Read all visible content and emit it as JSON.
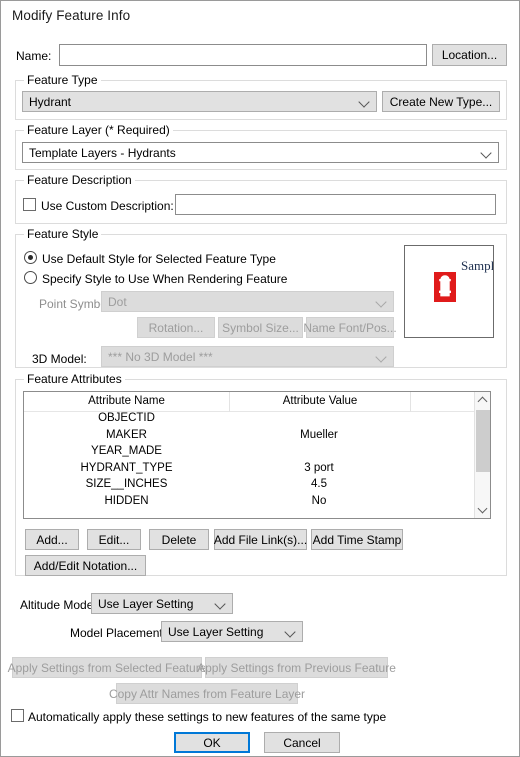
{
  "window": {
    "title": "Modify Feature Info"
  },
  "name_row": {
    "label": "Name:",
    "value": "",
    "placeholder": "",
    "location_button": "Location..."
  },
  "feature_type": {
    "group_title": "Feature Type",
    "selected": "Hydrant",
    "create_button": "Create New Type..."
  },
  "feature_layer": {
    "group_title": "Feature Layer (* Required)",
    "selected": "Template Layers - Hydrants"
  },
  "feature_description": {
    "group_title": "Feature Description",
    "checkbox_label": "Use Custom Description:",
    "checked": false,
    "value": ""
  },
  "feature_style": {
    "group_title": "Feature Style",
    "radio_default": "Use Default Style for Selected Feature Type",
    "radio_specify": "Specify Style to Use When Rendering Feature",
    "selected_radio": "default",
    "point_symbol_label": "Point Symbol",
    "point_symbol_value": "Dot",
    "rotation_button": "Rotation...",
    "symbol_size_button": "Symbol Size...",
    "name_font_button": "Name Font/Pos...",
    "model_3d_label": "3D Model:",
    "model_3d_value": "*** No 3D Model ***",
    "sample_text": "Sample",
    "sample_swatch_color": "#e01b1b"
  },
  "feature_attributes": {
    "group_title": "Feature Attributes",
    "columns": [
      "Attribute Name",
      "Attribute Value"
    ],
    "rows": [
      {
        "name": "OBJECTID",
        "value": ""
      },
      {
        "name": "MAKER",
        "value": "Mueller"
      },
      {
        "name": "YEAR_MADE",
        "value": ""
      },
      {
        "name": "HYDRANT_TYPE",
        "value": "3 port"
      },
      {
        "name": "SIZE__INCHES",
        "value": "4.5"
      },
      {
        "name": "HIDDEN",
        "value": "No"
      }
    ],
    "buttons": {
      "add": "Add...",
      "edit": "Edit...",
      "delete": "Delete",
      "add_file_links": "Add File Link(s)...",
      "add_time_stamp": "Add Time Stamp",
      "add_edit_notation": "Add/Edit Notation..."
    }
  },
  "altitude": {
    "label": "Altitude Mode:",
    "value": "Use Layer Setting"
  },
  "model_placement": {
    "label": "Model Placement:",
    "value": "Use Layer Setting"
  },
  "apply_buttons": {
    "from_selected": "Apply Settings from Selected Feature",
    "from_previous": "Apply Settings from Previous Feature",
    "copy_attr_names": "Copy Attr Names from Feature Layer"
  },
  "auto_apply": {
    "label": "Automatically apply these settings to new features of the same type",
    "checked": false
  },
  "footer": {
    "ok": "OK",
    "cancel": "Cancel"
  }
}
